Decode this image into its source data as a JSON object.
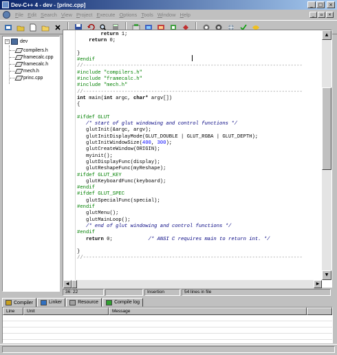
{
  "window": {
    "title": "Dev-C++ 4 - dev - [princ.cpp]",
    "controls": {
      "minimize": "_",
      "maximize": "□",
      "close": "×"
    },
    "mdi_controls": {
      "minimize": "_",
      "restore": "▫",
      "close": "×"
    }
  },
  "menu": {
    "items": [
      {
        "accel": "F",
        "rest": "ile"
      },
      {
        "accel": "E",
        "rest": "dit"
      },
      {
        "accel": "S",
        "rest": "earch"
      },
      {
        "accel": "V",
        "rest": "iew"
      },
      {
        "accel": "P",
        "rest": "roject"
      },
      {
        "accel": "E",
        "rest": "xecute"
      },
      {
        "accel": "O",
        "rest": "ptions"
      },
      {
        "accel": "T",
        "rest": "ools"
      },
      {
        "accel": "W",
        "rest": "indow"
      },
      {
        "accel": "H",
        "rest": "elp"
      }
    ]
  },
  "toolbar": {
    "groups": [
      [
        "new-project-icon",
        "open-project-icon",
        "new-file-icon",
        "open-file-icon",
        "close-file-icon"
      ],
      [
        "save-icon",
        "undo-icon",
        "find-icon",
        "calculator-icon"
      ],
      [
        "compile-icon",
        "run-icon",
        "compile-run-icon",
        "rebuild-icon",
        "debug-icon"
      ],
      [
        "add-to-project-icon",
        "remove-from-project-icon",
        "project-options-icon",
        "check-icon",
        "about-icon"
      ]
    ]
  },
  "project": {
    "root": "dev",
    "files": [
      "compilers.h",
      "framecalc.cpp",
      "framecalc.h",
      "mech.h",
      "princ.cpp"
    ]
  },
  "editor": {
    "lines": [
      [
        {
          "t": "        "
        },
        {
          "t": "return",
          "c": "kw"
        },
        {
          "t": " 1;"
        }
      ],
      [
        {
          "t": "    "
        },
        {
          "t": "return",
          "c": "kw"
        },
        {
          "t": " 0;"
        }
      ],
      [
        {
          "t": ""
        }
      ],
      [
        {
          "t": "}"
        }
      ],
      [
        {
          "t": "#endif",
          "c": "pp"
        }
      ],
      [
        {
          "t": "//--------------------------------------------------------------------------",
          "c": "sep"
        }
      ],
      [
        {
          "t": "#include \"compilers.h\"",
          "c": "pp"
        }
      ],
      [
        {
          "t": "#include \"framecalc.h\"",
          "c": "pp"
        }
      ],
      [
        {
          "t": "#include \"mech.h\"",
          "c": "pp"
        }
      ],
      [
        {
          "t": "//--------------------------------------------------------------------------",
          "c": "sep"
        }
      ],
      [
        {
          "t": "int",
          "c": "kw"
        },
        {
          "t": " main("
        },
        {
          "t": "int",
          "c": "kw"
        },
        {
          "t": " argc, "
        },
        {
          "t": "char*",
          "c": "kw"
        },
        {
          "t": " argv[])"
        }
      ],
      [
        {
          "t": "{"
        }
      ],
      [
        {
          "t": ""
        }
      ],
      [
        {
          "t": "#ifdef GLUT",
          "c": "pp"
        }
      ],
      [
        {
          "t": "   "
        },
        {
          "t": "/* start of glut windowing and control functions */",
          "c": "cm"
        }
      ],
      [
        {
          "t": "   glutInit(&argc, argv);"
        }
      ],
      [
        {
          "t": "   glutInitDisplayMode(GLUT_DOUBLE | GLUT_RGBA | GLUT_DEPTH);"
        }
      ],
      [
        {
          "t": "   glutInitWindowSize("
        },
        {
          "t": "400",
          "c": "num"
        },
        {
          "t": ", "
        },
        {
          "t": "300",
          "c": "num"
        },
        {
          "t": ");"
        }
      ],
      [
        {
          "t": "   glutCreateWindow(ORIGIN);"
        }
      ],
      [
        {
          "t": "   myinit();"
        }
      ],
      [
        {
          "t": "   glutDisplayFunc(display);"
        }
      ],
      [
        {
          "t": "   glutReshapeFunc(myReshape);"
        }
      ],
      [
        {
          "t": "#ifdef GLUT_KEY",
          "c": "pp"
        }
      ],
      [
        {
          "t": "   glutKeyboardFunc(keyboard);"
        }
      ],
      [
        {
          "t": "#endif",
          "c": "pp"
        }
      ],
      [
        {
          "t": "#ifdef GLUT_SPEC",
          "c": "pp"
        }
      ],
      [
        {
          "t": "   glutSpecialFunc(special);"
        }
      ],
      [
        {
          "t": "#endif",
          "c": "pp"
        }
      ],
      [
        {
          "t": "   glutMenu();"
        }
      ],
      [
        {
          "t": "   glutMainLoop();"
        }
      ],
      [
        {
          "t": "   "
        },
        {
          "t": "/* end of glut windowing and control functions */",
          "c": "cm"
        }
      ],
      [
        {
          "t": "#endif",
          "c": "pp"
        }
      ],
      [
        {
          "t": "   "
        },
        {
          "t": "return",
          "c": "kw"
        },
        {
          "t": " 0;            "
        },
        {
          "t": "/* ANSI C requires main to return int. */",
          "c": "cm"
        }
      ],
      [
        {
          "t": ""
        }
      ],
      [
        {
          "t": "}"
        }
      ],
      [
        {
          "t": "//--------------------------------------------------------------------------",
          "c": "sep"
        }
      ]
    ]
  },
  "scrollbar": {
    "up": "▲",
    "down": "▼",
    "left": "◀",
    "right": "▶"
  },
  "status": {
    "position": "36: 22",
    "mode": "Insertion",
    "lines": "54 lines in file"
  },
  "bottom_tabs": [
    "Compiler",
    "Linker",
    "Resource",
    "Compile log"
  ],
  "results": {
    "columns": [
      "Line",
      "Unit",
      "Message"
    ]
  },
  "colors": {
    "title_start": "#0a246a",
    "title_end": "#a6caf0",
    "preprocessor": "#008000",
    "number": "#0000ff",
    "comment": "#000080"
  }
}
